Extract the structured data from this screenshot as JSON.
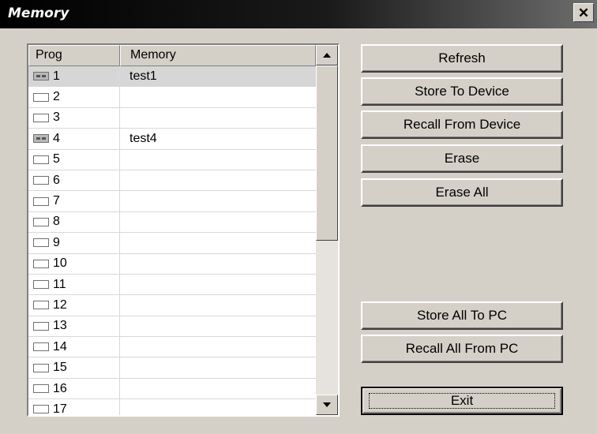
{
  "window": {
    "title": "Memory",
    "close_label": "✕"
  },
  "list": {
    "columns": [
      "Prog",
      "Memory"
    ],
    "rows": [
      {
        "prog": "1",
        "memory": "test1",
        "filled": true,
        "selected": true
      },
      {
        "prog": "2",
        "memory": "",
        "filled": false,
        "selected": false
      },
      {
        "prog": "3",
        "memory": "",
        "filled": false,
        "selected": false
      },
      {
        "prog": "4",
        "memory": "test4",
        "filled": true,
        "selected": false
      },
      {
        "prog": "5",
        "memory": "",
        "filled": false,
        "selected": false
      },
      {
        "prog": "6",
        "memory": "",
        "filled": false,
        "selected": false
      },
      {
        "prog": "7",
        "memory": "",
        "filled": false,
        "selected": false
      },
      {
        "prog": "8",
        "memory": "",
        "filled": false,
        "selected": false
      },
      {
        "prog": "9",
        "memory": "",
        "filled": false,
        "selected": false
      },
      {
        "prog": "10",
        "memory": "",
        "filled": false,
        "selected": false
      },
      {
        "prog": "11",
        "memory": "",
        "filled": false,
        "selected": false
      },
      {
        "prog": "12",
        "memory": "",
        "filled": false,
        "selected": false
      },
      {
        "prog": "13",
        "memory": "",
        "filled": false,
        "selected": false
      },
      {
        "prog": "14",
        "memory": "",
        "filled": false,
        "selected": false
      },
      {
        "prog": "15",
        "memory": "",
        "filled": false,
        "selected": false
      },
      {
        "prog": "16",
        "memory": "",
        "filled": false,
        "selected": false
      },
      {
        "prog": "17",
        "memory": "",
        "filled": false,
        "selected": false
      }
    ]
  },
  "buttons": {
    "refresh": "Refresh",
    "store_to_device": "Store To Device",
    "recall_from_device": "Recall From Device",
    "erase": "Erase",
    "erase_all": "Erase All",
    "store_all_to_pc": "Store All To PC",
    "recall_all_from_pc": "Recall All From PC",
    "exit": "Exit"
  },
  "icons": {
    "close": "close-icon",
    "scroll_up": "scroll-up-arrow-icon",
    "scroll_down": "scroll-down-arrow-icon",
    "slot_filled": "memory-slot-filled-icon",
    "slot_empty": "memory-slot-empty-icon"
  }
}
